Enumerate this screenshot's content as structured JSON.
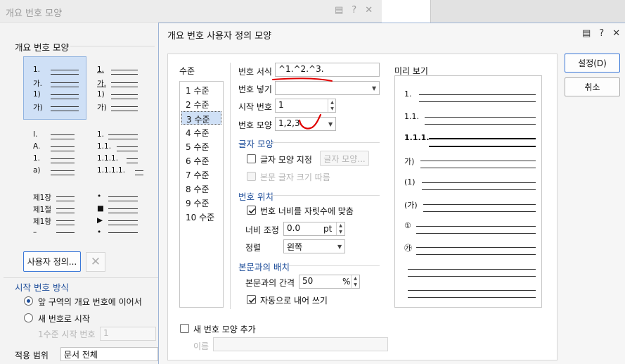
{
  "bg_dialog": {
    "title": "개요 번호 모양",
    "icons": [
      "comment-icon",
      "help-icon",
      "close-icon"
    ],
    "group_title": "개요 번호 모양",
    "thumbs": [
      {
        "rows": [
          "1.",
          "가.",
          "1)",
          "가)"
        ]
      },
      {
        "rows": [
          "1.",
          "가.",
          "1)",
          "가)"
        ]
      },
      {
        "rows": [
          "I.",
          "A.",
          "1.",
          "a)"
        ]
      },
      {
        "rows": [
          "1.",
          "1.1.",
          "1.1.1.",
          "1.1.1.1."
        ]
      },
      {
        "rows": [
          "제1장",
          "제1절",
          "제1항",
          "–"
        ]
      },
      {
        "rows": [
          "•",
          "■",
          "▶",
          "•"
        ]
      }
    ],
    "custom_button": "사용자 정의...",
    "start_group": "시작 번호 방식",
    "radio_continue": "앞 구역의 개요 번호에 이어서",
    "radio_new": "새 번호로 시작",
    "level1_start_label": "1수준 시작 번호",
    "level1_start_value": "1",
    "apply_label": "적용 범위",
    "apply_value": "문서 전체"
  },
  "main_dialog": {
    "title": "개요 번호 사용자 정의 모양",
    "icons": [
      "comment-icon",
      "help-icon",
      "close-icon"
    ],
    "levels_label": "수준",
    "levels": [
      "1 수준",
      "2 수준",
      "3 수준",
      "4 수준",
      "5 수준",
      "6 수준",
      "7 수준",
      "8 수준",
      "9 수준",
      "10 수준"
    ],
    "selected_level": "3 수준",
    "number_format_label": "번호 서식",
    "number_format_value": "^1.^2.^3.",
    "number_insert_label": "번호 넣기",
    "number_insert_value": "",
    "start_number_label": "시작 번호",
    "start_number_value": "1",
    "number_shape_label": "번호 모양",
    "number_shape_value": "1,2,3",
    "char_group": "글자 모양",
    "char_shape_check": "글자 모양 지정",
    "char_shape_button": "글자 모양...",
    "follow_size_check": "본문 글자 크기 따름",
    "pos_group": "번호 위치",
    "fit_width_check": "번호 너비를 자릿수에 맞춤",
    "width_adjust_label": "너비 조정",
    "width_adjust_value": "0.0",
    "width_adjust_unit": "pt",
    "align_label": "정렬",
    "align_value": "왼쪽",
    "layout_group": "본문과의 배치",
    "gap_label": "본문과의 간격",
    "gap_value": "50",
    "gap_unit": "%",
    "auto_indent_check": "자동으로 내어 쓰기",
    "preview_label": "미리 보기",
    "preview_numbers": [
      "1.",
      "1.1.",
      "1.1.1.",
      "가)",
      "(1)",
      "(가)",
      "①",
      "㉮"
    ],
    "add_shape_check": "새 번호 모양 추가",
    "name_label": "이름",
    "name_value": "",
    "set_button": "설정(D)",
    "cancel_button": "취소"
  },
  "colors": {
    "accent": "#3b78d8",
    "group_title": "#1f4e9a",
    "annotation_red": "#e00000"
  }
}
